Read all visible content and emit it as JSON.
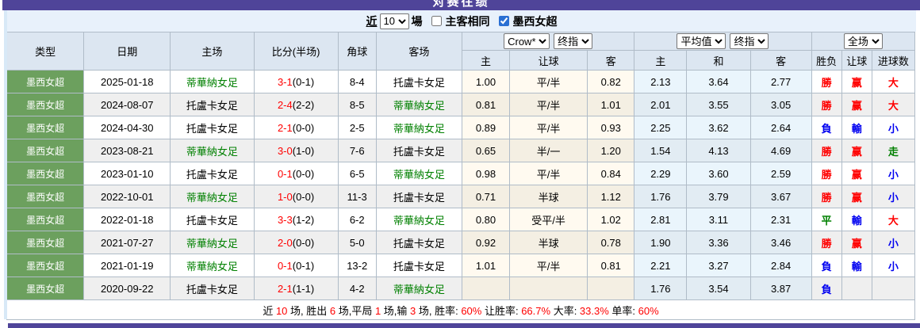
{
  "titlebar": {
    "title": "对赛往绩"
  },
  "controls": {
    "recent_label": "近",
    "recent_select_value": "10",
    "games_label": "場",
    "same_venue_label": "主客相同",
    "same_venue_checked": false,
    "league_filter_label": "墨西女超",
    "league_filter_checked": true
  },
  "table": {
    "group_selects": {
      "company": "Crow*",
      "asia_stage": "终指",
      "euro_value": "平均值",
      "euro_stage": "终指",
      "scope": "全场"
    },
    "columns": {
      "type": "类型",
      "date": "日期",
      "home": "主场",
      "score": "比分(半场)",
      "corner": "角球",
      "away": "客场",
      "asia_home": "主",
      "asia_line": "让球",
      "asia_away": "客",
      "euro_home": "主",
      "euro_draw": "和",
      "euro_away": "客",
      "result_wdl": "胜负",
      "result_handicap": "让球",
      "result_goals": "进球数"
    },
    "rows": [
      {
        "league": "墨西女超",
        "date": "2025-01-18",
        "home": "蒂華納女足",
        "home_focus": true,
        "ft": "3-1",
        "ht": "(0-1)",
        "corner": "8-4",
        "away": "托盧卡女足",
        "away_focus": false,
        "asia": [
          "1.00",
          "平/半",
          "0.82"
        ],
        "euro": [
          "2.13",
          "3.64",
          "2.77"
        ],
        "results": [
          "勝",
          "赢",
          "大"
        ]
      },
      {
        "league": "墨西女超",
        "date": "2024-08-07",
        "home": "托盧卡女足",
        "home_focus": false,
        "ft": "2-4",
        "ht": "(2-2)",
        "corner": "8-5",
        "away": "蒂華納女足",
        "away_focus": true,
        "asia": [
          "0.81",
          "平/半",
          "1.01"
        ],
        "euro": [
          "2.01",
          "3.55",
          "3.05"
        ],
        "results": [
          "勝",
          "赢",
          "大"
        ]
      },
      {
        "league": "墨西女超",
        "date": "2024-04-30",
        "home": "托盧卡女足",
        "home_focus": false,
        "ft": "2-1",
        "ht": "(0-0)",
        "corner": "2-5",
        "away": "蒂華納女足",
        "away_focus": true,
        "asia": [
          "0.89",
          "平/半",
          "0.93"
        ],
        "euro": [
          "2.25",
          "3.62",
          "2.64"
        ],
        "results": [
          "負",
          "輸",
          "小"
        ]
      },
      {
        "league": "墨西女超",
        "date": "2023-08-21",
        "home": "蒂華納女足",
        "home_focus": true,
        "ft": "3-0",
        "ht": "(1-0)",
        "corner": "7-6",
        "away": "托盧卡女足",
        "away_focus": false,
        "asia": [
          "0.65",
          "半/一",
          "1.20"
        ],
        "euro": [
          "1.54",
          "4.13",
          "4.69"
        ],
        "results": [
          "勝",
          "赢",
          "走"
        ]
      },
      {
        "league": "墨西女超",
        "date": "2023-01-10",
        "home": "托盧卡女足",
        "home_focus": false,
        "ft": "0-1",
        "ht": "(0-0)",
        "corner": "6-5",
        "away": "蒂華納女足",
        "away_focus": true,
        "asia": [
          "0.98",
          "平/半",
          "0.84"
        ],
        "euro": [
          "2.29",
          "3.60",
          "2.59"
        ],
        "results": [
          "勝",
          "赢",
          "小"
        ]
      },
      {
        "league": "墨西女超",
        "date": "2022-10-01",
        "home": "蒂華納女足",
        "home_focus": true,
        "ft": "1-0",
        "ht": "(0-0)",
        "corner": "11-3",
        "away": "托盧卡女足",
        "away_focus": false,
        "asia": [
          "0.71",
          "半球",
          "1.12"
        ],
        "euro": [
          "1.76",
          "3.79",
          "3.67"
        ],
        "results": [
          "勝",
          "赢",
          "小"
        ]
      },
      {
        "league": "墨西女超",
        "date": "2022-01-18",
        "home": "托盧卡女足",
        "home_focus": false,
        "ft": "3-3",
        "ht": "(1-2)",
        "corner": "6-2",
        "away": "蒂華納女足",
        "away_focus": true,
        "asia": [
          "0.80",
          "受平/半",
          "1.02"
        ],
        "euro": [
          "2.81",
          "3.11",
          "2.31"
        ],
        "results": [
          "平",
          "輸",
          "大"
        ]
      },
      {
        "league": "墨西女超",
        "date": "2021-07-27",
        "home": "蒂華納女足",
        "home_focus": true,
        "ft": "2-0",
        "ht": "(0-0)",
        "corner": "5-0",
        "away": "托盧卡女足",
        "away_focus": false,
        "asia": [
          "0.92",
          "半球",
          "0.78"
        ],
        "euro": [
          "1.90",
          "3.36",
          "3.46"
        ],
        "results": [
          "勝",
          "赢",
          "小"
        ]
      },
      {
        "league": "墨西女超",
        "date": "2021-01-19",
        "home": "蒂華納女足",
        "home_focus": true,
        "ft": "0-1",
        "ht": "(0-1)",
        "corner": "13-2",
        "away": "托盧卡女足",
        "away_focus": false,
        "asia": [
          "1.01",
          "平/半",
          "0.81"
        ],
        "euro": [
          "2.21",
          "3.27",
          "2.84"
        ],
        "results": [
          "負",
          "輸",
          "小"
        ]
      },
      {
        "league": "墨西女超",
        "date": "2020-09-22",
        "home": "托盧卡女足",
        "home_focus": false,
        "ft": "2-1",
        "ht": "(1-1)",
        "corner": "4-2",
        "away": "蒂華納女足",
        "away_focus": true,
        "asia": [
          "",
          "",
          ""
        ],
        "euro": [
          "1.76",
          "3.54",
          "3.87"
        ],
        "results": [
          "負",
          "",
          ""
        ]
      }
    ]
  },
  "summary": {
    "segments": [
      {
        "text": "近 ",
        "red": false
      },
      {
        "text": "10",
        "red": true
      },
      {
        "text": " 场, 胜出 ",
        "red": false
      },
      {
        "text": "6",
        "red": true
      },
      {
        "text": " 场,平局 ",
        "red": false
      },
      {
        "text": "1",
        "red": true
      },
      {
        "text": " 场,输 ",
        "red": false
      },
      {
        "text": "3",
        "red": true
      },
      {
        "text": " 场, 胜率: ",
        "red": false
      },
      {
        "text": "60%",
        "red": true
      },
      {
        "text": " 让胜率: ",
        "red": false
      },
      {
        "text": "66.7%",
        "red": true
      },
      {
        "text": " 大率: ",
        "red": false
      },
      {
        "text": "33.3%",
        "red": true
      },
      {
        "text": " 单率: ",
        "red": false
      },
      {
        "text": "60%",
        "red": true
      }
    ]
  },
  "colors": {
    "accent_purple": "#4f4499",
    "league_green": "#6ca05e",
    "focus_team_green": "#008000",
    "win_red": "#ff0000",
    "lose_blue": "#0000f0",
    "header_bg": "#dce6f1",
    "controls_bg": "#e8f1fb"
  }
}
